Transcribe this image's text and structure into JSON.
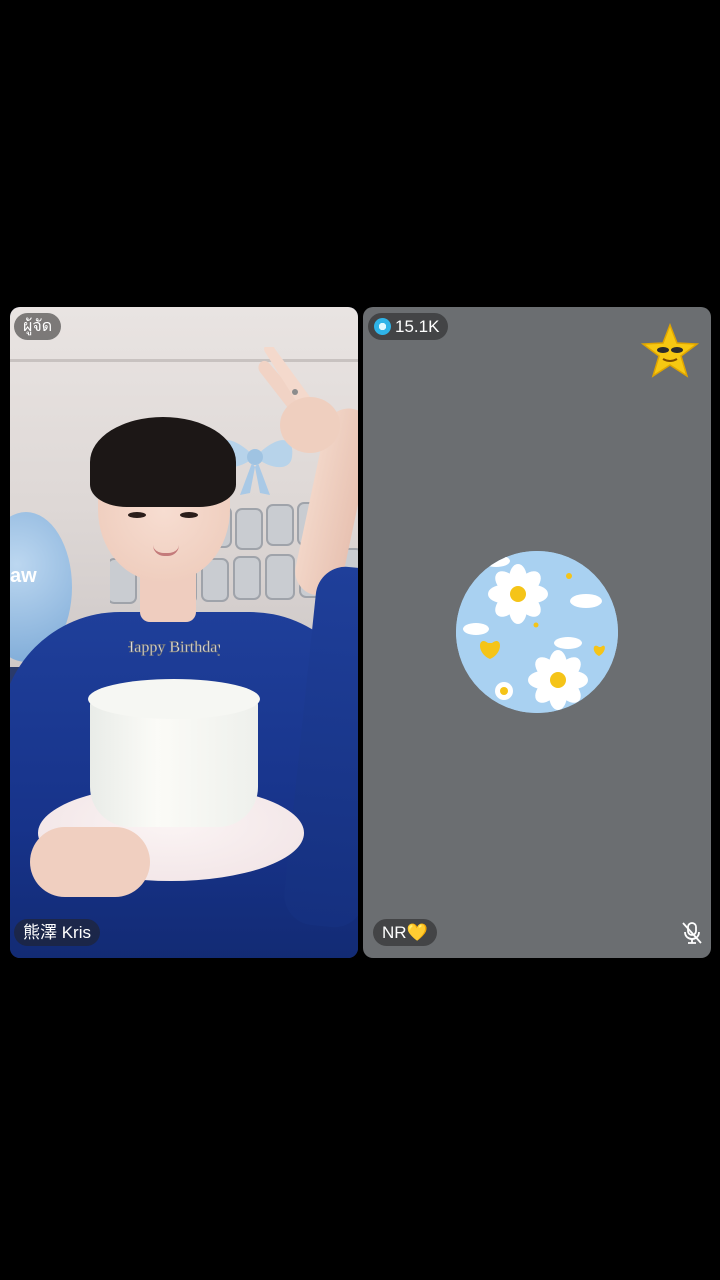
{
  "left_panel": {
    "host_label": "ผู้จัด",
    "name": "熊澤 Kris",
    "balloon_text": "aw",
    "cake_topper": "Happy Birthday"
  },
  "right_panel": {
    "score": "15.1K",
    "name": "NR",
    "name_emoji": "💛",
    "score_icon": "gem-icon",
    "status_icon": "mic-off-icon",
    "badge_icon": "star-face-icon"
  },
  "colors": {
    "background": "#000000",
    "right_panel_bg": "#6b6e71",
    "avatar_bg": "#a9d1f1",
    "accent_yellow": "#f5c418"
  }
}
